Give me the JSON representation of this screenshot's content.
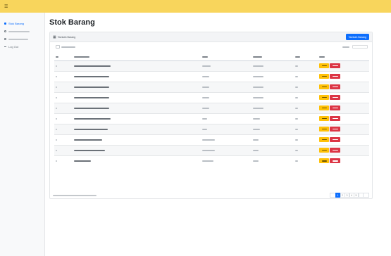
{
  "app": {
    "title": "",
    "brand_color": "#f8d55c",
    "accent_color": "#0d6efd"
  },
  "sidebar": {
    "items": [
      {
        "label": "Stok Barang",
        "icon": "table-icon",
        "active": true
      },
      {
        "label": "",
        "icon": "inbox-icon",
        "active": false
      },
      {
        "label": "",
        "icon": "outbox-icon",
        "active": false
      },
      {
        "label": "Log Out",
        "icon": "logout-icon",
        "active": false
      }
    ]
  },
  "page": {
    "title": "Stok Barang"
  },
  "card": {
    "header_title": "Tambah Barang",
    "add_button_label": "Tambah Barang"
  },
  "table": {
    "entries_value": "",
    "entries_suffix": "",
    "search_label": "",
    "search_value": "",
    "columns": [
      "",
      "",
      "",
      "",
      "",
      ""
    ],
    "rows": [
      {
        "no": "",
        "name": "",
        "merk": "",
        "desc": "",
        "stock": "",
        "edit_label": "",
        "delete_label": ""
      },
      {
        "no": "",
        "name": "",
        "merk": "",
        "desc": "",
        "stock": "",
        "edit_label": "",
        "delete_label": ""
      },
      {
        "no": "",
        "name": "",
        "merk": "",
        "desc": "",
        "stock": "",
        "edit_label": "",
        "delete_label": ""
      },
      {
        "no": "",
        "name": "",
        "merk": "",
        "desc": "",
        "stock": "",
        "edit_label": "",
        "delete_label": ""
      },
      {
        "no": "",
        "name": "",
        "merk": "",
        "desc": "",
        "stock": "",
        "edit_label": "",
        "delete_label": ""
      },
      {
        "no": "",
        "name": "",
        "merk": "",
        "desc": "",
        "stock": "",
        "edit_label": "",
        "delete_label": ""
      },
      {
        "no": "",
        "name": "",
        "merk": "",
        "desc": "",
        "stock": "",
        "edit_label": "",
        "delete_label": ""
      },
      {
        "no": "",
        "name": "",
        "merk": "",
        "desc": "",
        "stock": "",
        "edit_label": "",
        "delete_label": ""
      },
      {
        "no": "",
        "name": "",
        "merk": "",
        "desc": "",
        "stock": "",
        "edit_label": "",
        "delete_label": ""
      },
      {
        "no": "",
        "name": "",
        "merk": "",
        "desc": "",
        "stock": "",
        "edit_label": "",
        "delete_label": ""
      }
    ],
    "colors": {
      "edit_button": "#ffc107",
      "delete_button": "#dc3545"
    }
  },
  "footer": {
    "info": "",
    "pagination": [
      "",
      "1",
      "2",
      "3",
      "4",
      "5",
      "",
      ""
    ],
    "active_page": "1"
  }
}
